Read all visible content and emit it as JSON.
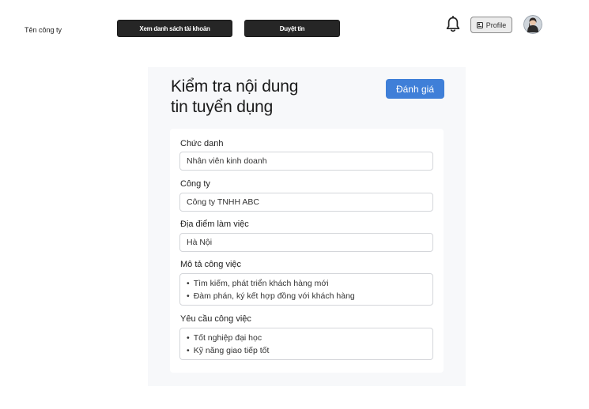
{
  "header": {
    "brand": "Tên công ty",
    "nav_accounts": "Xem danh sách tài khoản",
    "nav_review": "Duyệt tin",
    "profile_label": "Profile"
  },
  "panel": {
    "title_line1": "Kiểm tra nội dung",
    "title_line2": "tin tuyển dụng",
    "rate_button": "Đánh giá"
  },
  "form": {
    "job_title": {
      "label": "Chức danh",
      "value": "Nhân viên kinh doanh"
    },
    "company": {
      "label": "Công ty",
      "value": "Công ty TNHH ABC"
    },
    "location": {
      "label": "Địa điểm làm việc",
      "value": "Hà Nội"
    },
    "description": {
      "label": "Mô tả công việc",
      "items": [
        "Tìm kiếm, phát triển khách hàng mới",
        "Đàm phán, ký kết hợp đồng với khách hàng"
      ]
    },
    "requirements": {
      "label": "Yêu cầu công việc",
      "items": [
        "Tốt nghiệp đại học",
        "Kỹ năng giao tiếp  tốt"
      ]
    }
  },
  "colors": {
    "primary": "#3f7fd8",
    "nav_button_bg": "#262626",
    "panel_bg": "#f7f8fa"
  },
  "icons": {
    "bell": "bell-icon",
    "profile": "profile-card-icon",
    "avatar": "user-avatar"
  }
}
